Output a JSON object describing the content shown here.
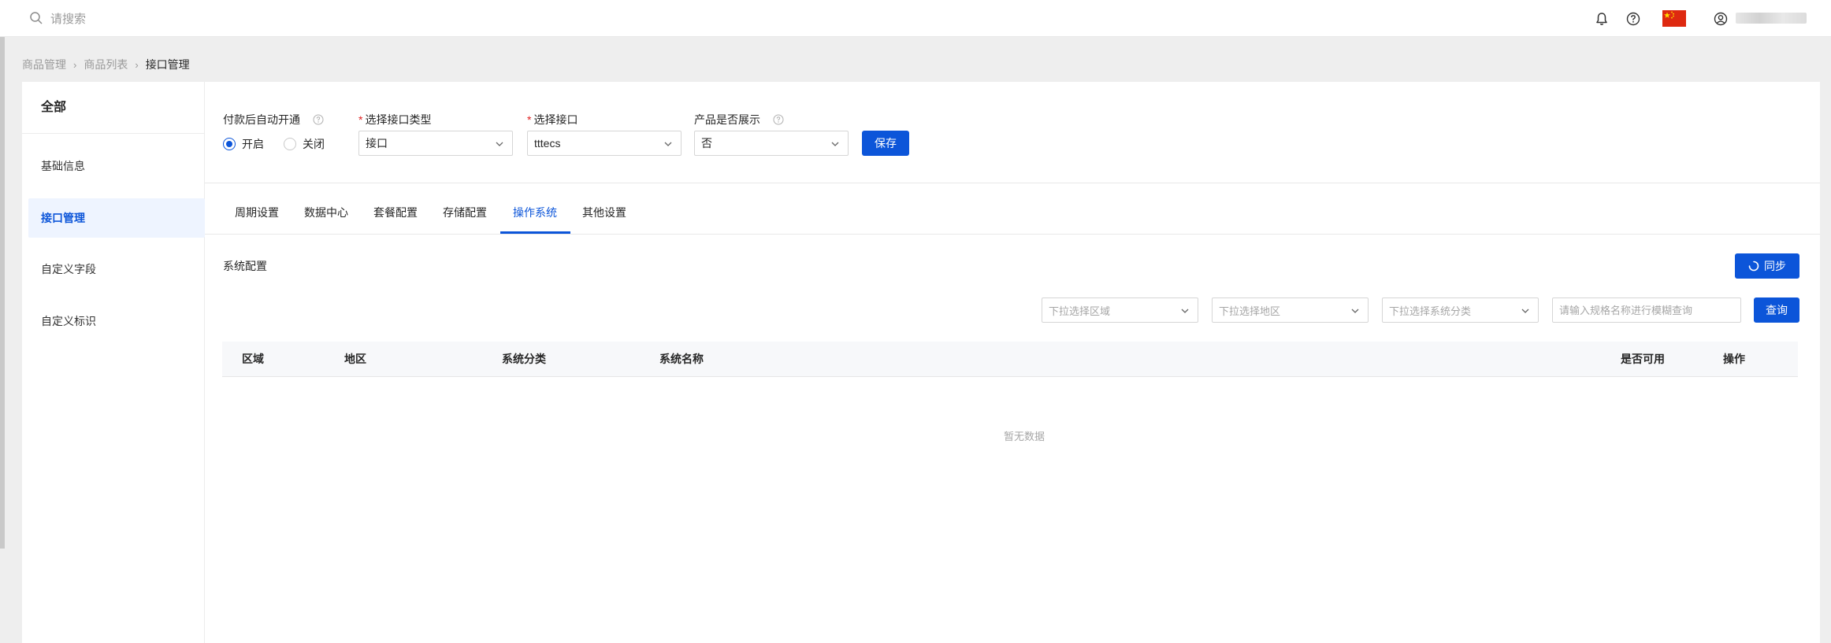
{
  "topbar": {
    "search_placeholder": "请搜索",
    "icons": [
      "search-icon",
      "bell-icon",
      "help-circle-icon",
      "china-flag-icon",
      "user-circle-icon"
    ],
    "flag_color": "#de2910"
  },
  "breadcrumb": [
    "商品管理",
    "商品列表",
    "接口管理"
  ],
  "sidebar": {
    "title": "全部",
    "items": [
      {
        "label": "基础信息",
        "active": false
      },
      {
        "label": "接口管理",
        "active": true
      },
      {
        "label": "自定义字段",
        "active": false
      },
      {
        "label": "自定义标识",
        "active": false
      }
    ]
  },
  "form": {
    "auto_open_label": "付款后自动开通",
    "radio_on": "开启",
    "radio_off": "关闭",
    "radio_selected": "开启",
    "interface_type_label": "选择接口类型",
    "interface_type_value": "接口",
    "interface_label": "选择接口",
    "interface_value": "tttecs",
    "show_label": "产品是否展示",
    "show_value": "否",
    "save_button": "保存"
  },
  "tabs": [
    {
      "label": "周期设置",
      "active": false
    },
    {
      "label": "数据中心",
      "active": false
    },
    {
      "label": "套餐配置",
      "active": false
    },
    {
      "label": "存储配置",
      "active": false
    },
    {
      "label": "操作系统",
      "active": true
    },
    {
      "label": "其他设置",
      "active": false
    }
  ],
  "system_config": {
    "title": "系统配置",
    "sync_button": "同步",
    "filters": {
      "region_placeholder": "下拉选择区域",
      "area_placeholder": "下拉选择地区",
      "category_placeholder": "下拉选择系统分类",
      "keyword_placeholder": "请输入规格名称进行模糊查询",
      "query_button": "查询"
    },
    "table": {
      "columns": [
        "区域",
        "地区",
        "系统分类",
        "系统名称",
        "是否可用",
        "操作"
      ],
      "rows": [],
      "empty_text": "暂无数据"
    }
  },
  "colors": {
    "primary": "#0c55d9",
    "required": "#e02020",
    "page_background": "#eeeeee"
  }
}
